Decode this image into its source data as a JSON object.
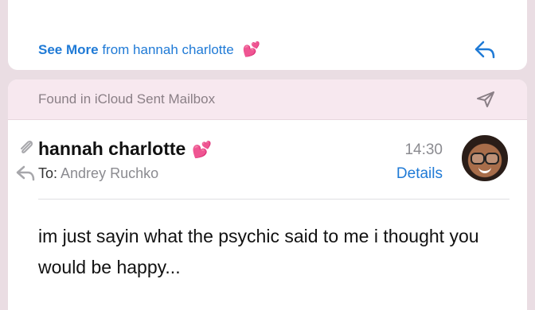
{
  "previous_message": {
    "see_more_label": "See More",
    "from_label": "from hannah charlotte",
    "heart_emoji": "💕"
  },
  "found_bar": {
    "text": "Found in iCloud Sent Mailbox"
  },
  "email": {
    "sender": "hannah charlotte",
    "heart_emoji": "💕",
    "time": "14:30",
    "to_label": "To:",
    "recipient": "Andrey Ruchko",
    "details_label": "Details",
    "body": "im just sayin what the psychic said to me i thought you would be happy..."
  },
  "colors": {
    "accent": "#1f7ad6",
    "background": "#eadde3",
    "found_bar": "#f7e8ef"
  }
}
